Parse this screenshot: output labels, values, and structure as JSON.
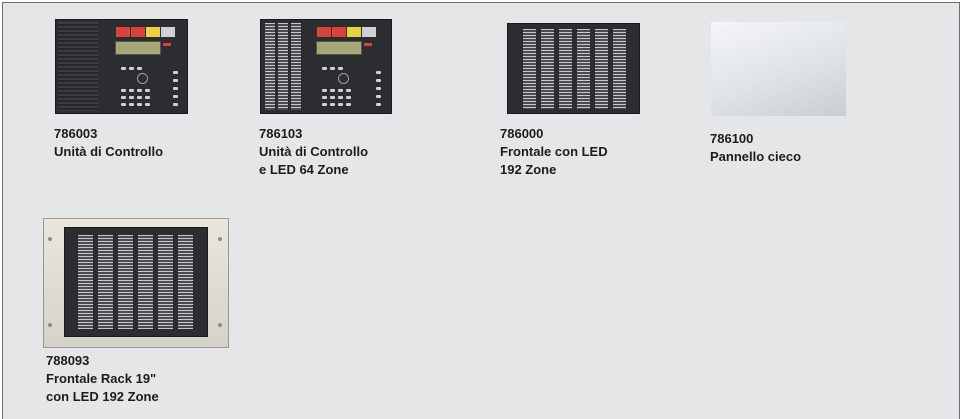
{
  "products": [
    {
      "code": "786003",
      "lines": [
        "Unità di Controllo"
      ],
      "image": "control-unit-panel"
    },
    {
      "code": "786103",
      "lines": [
        "Unità di Controllo",
        "e LED 64 Zone"
      ],
      "image": "control-unit-led-panel"
    },
    {
      "code": "786000",
      "lines": [
        "Frontale con LED",
        "192 Zone"
      ],
      "image": "led-front-panel"
    },
    {
      "code": "786100",
      "lines": [
        "Pannello cieco"
      ],
      "image": "blank-panel"
    },
    {
      "code": "788093",
      "lines": [
        "Frontale Rack 19\"",
        "con LED 192 Zone"
      ],
      "image": "rack-led-panel"
    }
  ],
  "colors": {
    "background": "#e5e6e8",
    "border": "#6e6f72",
    "panel": "#2b2d31",
    "text": "#1c1c1c",
    "alarm_red": "#d8443a",
    "warning_yellow": "#e8d24a"
  }
}
